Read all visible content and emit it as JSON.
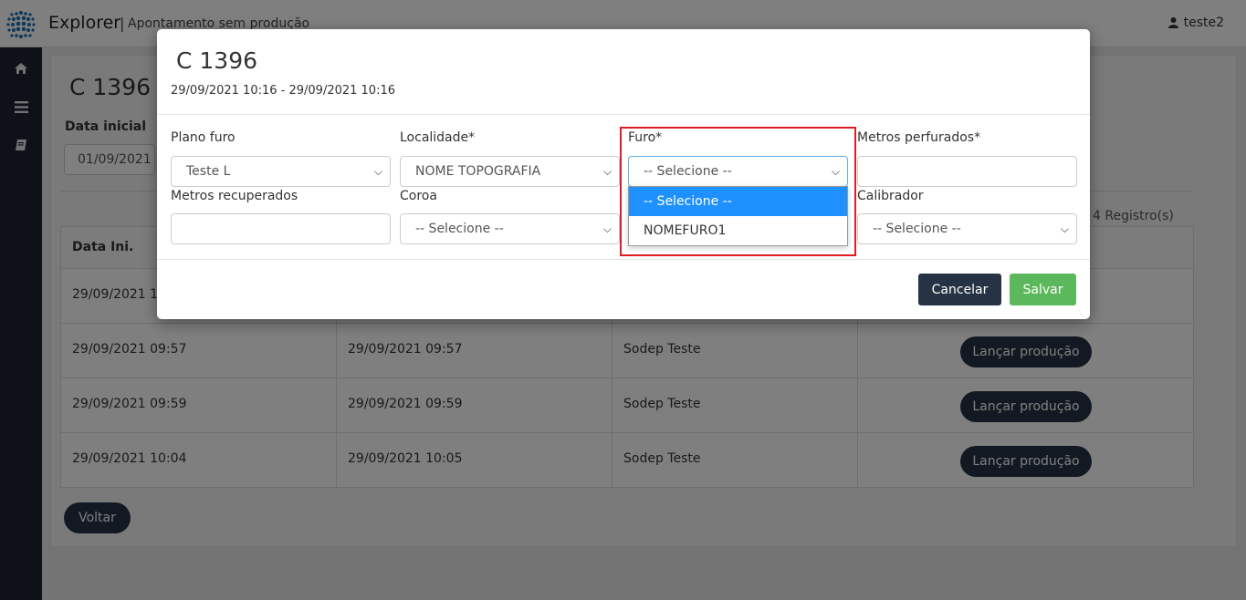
{
  "header": {
    "app_name": "Explorer",
    "separator": "|",
    "subtitle": "Apontamento sem produção",
    "user": "teste2",
    "logo_icon": "logo-dots"
  },
  "sidebar": {
    "items": [
      {
        "icon": "home-icon"
      },
      {
        "icon": "menu-icon"
      },
      {
        "icon": "book-icon"
      }
    ]
  },
  "page": {
    "title": "C 1396",
    "filter_label": "Data inicial",
    "filter_value": "01/09/2021",
    "records": "4 Registro(s)",
    "back_label": "Voltar"
  },
  "table": {
    "headers": [
      "Data Ini.",
      "",
      "",
      ""
    ],
    "rows": [
      {
        "c1": "29/09/2021 10:",
        "c2": "",
        "c3": "",
        "action": ""
      },
      {
        "c1": "29/09/2021 09:57",
        "c2": "29/09/2021 09:57",
        "c3": "Sodep Teste",
        "action": "Lançar produção"
      },
      {
        "c1": "29/09/2021 09:59",
        "c2": "29/09/2021 09:59",
        "c3": "Sodep Teste",
        "action": "Lançar produção"
      },
      {
        "c1": "29/09/2021 10:04",
        "c2": "29/09/2021 10:05",
        "c3": "Sodep Teste",
        "action": "Lançar produção"
      }
    ]
  },
  "modal": {
    "title": "C 1396",
    "subtitle": "29/09/2021 10:16 - 29/09/2021 10:16",
    "fields": {
      "plano_furo": {
        "label": "Plano furo",
        "value": "Teste L"
      },
      "localidade": {
        "label": "Localidade*",
        "value": "NOME TOPOGRAFIA"
      },
      "furo": {
        "label": "Furo*",
        "value": "-- Selecione --"
      },
      "metros_perfurados": {
        "label": "Metros perfurados*",
        "value": ""
      },
      "metros_recuperados": {
        "label": "Metros recuperados",
        "value": ""
      },
      "coroa": {
        "label": "Coroa",
        "value": "-- Selecione --"
      },
      "calibrador": {
        "label": "Calibrador",
        "value": "-- Selecione --"
      }
    },
    "furo_options": [
      "-- Selecione --",
      "NOMEFURO1"
    ],
    "cancel_label": "Cancelar",
    "save_label": "Salvar"
  },
  "colors": {
    "sidebar": "#1c2430",
    "dark_button": "#263344",
    "save_button": "#5cb85c",
    "option_selected": "#1e90ff",
    "highlight": "#e01b24"
  }
}
